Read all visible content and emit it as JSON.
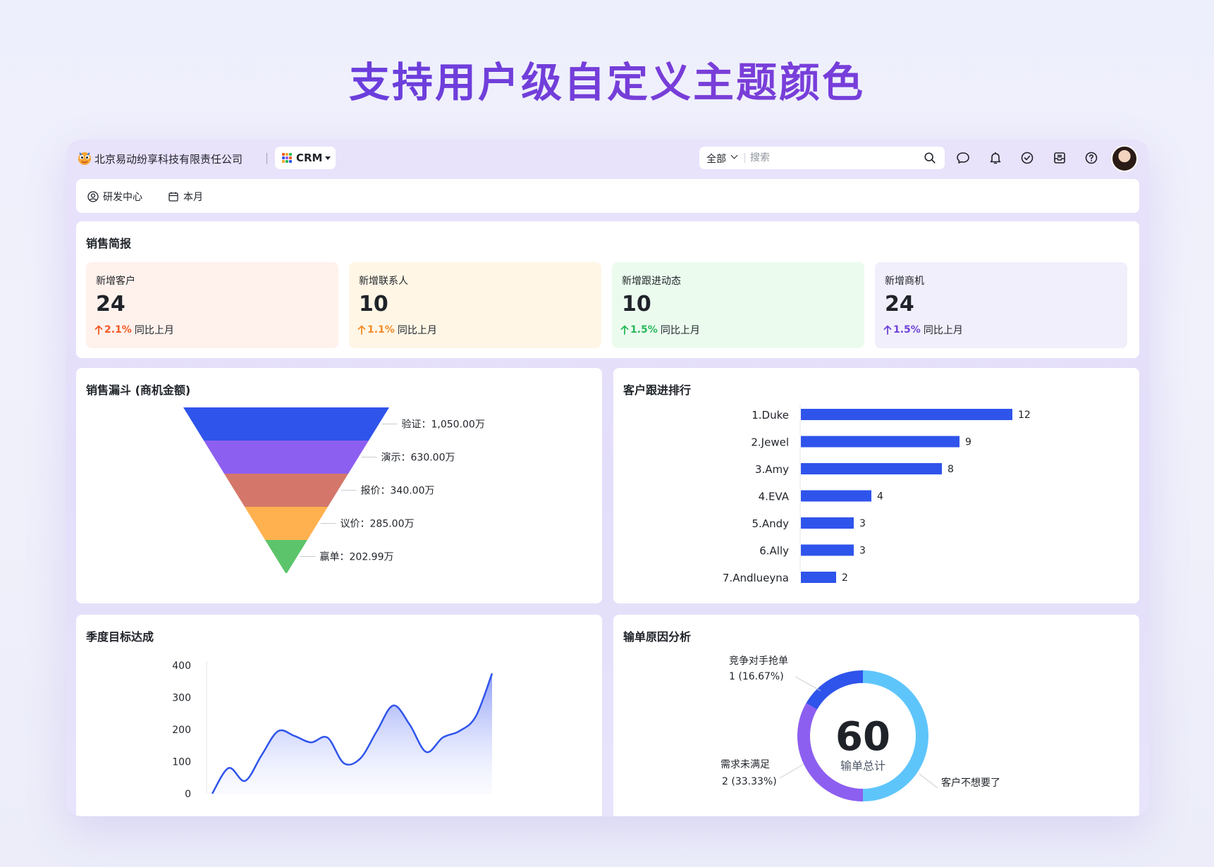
{
  "hero": {
    "title": "支持用户级自定义主题颜色"
  },
  "topbar": {
    "company": "北京易动纷享科技有限责任公司",
    "app_name": "CRM",
    "search_scope": "全部",
    "search_placeholder": "搜索"
  },
  "filters": {
    "department": "研发中心",
    "period": "本月"
  },
  "sales_brief": {
    "title": "销售简报",
    "stats": [
      {
        "label": "新增客户",
        "value": "24",
        "change": "2.1%",
        "compare": "同比上月",
        "color": "#f15a24",
        "bg": "#fff1ec"
      },
      {
        "label": "新增联系人",
        "value": "10",
        "change": "1.1%",
        "compare": "同比上月",
        "color": "#f28c28",
        "bg": "#fff6e6"
      },
      {
        "label": "新增跟进动态",
        "value": "10",
        "change": "1.5%",
        "compare": "同比上月",
        "color": "#2ab85a",
        "bg": "#ebfcef"
      },
      {
        "label": "新增商机",
        "value": "24",
        "change": "1.5%",
        "compare": "同比上月",
        "color": "#6e44d8",
        "bg": "#f1effb"
      }
    ]
  },
  "funnel": {
    "title": "销售漏斗 (商机金额)",
    "chart_data": {
      "type": "funnel",
      "stages": [
        {
          "name": "验证",
          "value": 1050.0,
          "label": "验证：1,050.00万",
          "color": "#2f54eb"
        },
        {
          "name": "演示",
          "value": 630.0,
          "label": "演示：630.00万",
          "color": "#8d5ff0"
        },
        {
          "name": "报价",
          "value": 340.0,
          "label": "报价：340.00万",
          "color": "#d4776a"
        },
        {
          "name": "议价",
          "value": 285.0,
          "label": "议价：285.00万",
          "color": "#ffb14f"
        },
        {
          "name": "赢单",
          "value": 202.99,
          "label": "赢单：202.99万",
          "color": "#5cc46a"
        }
      ]
    }
  },
  "ranking": {
    "title": "客户跟进排行",
    "chart_data": {
      "type": "bar",
      "orientation": "horizontal",
      "categories": [
        "1.Duke",
        "2.Jewel",
        "3.Amy",
        "4.EVA",
        "5.Andy",
        "6.Ally",
        "7.Andlueyna"
      ],
      "values": [
        12,
        9,
        8,
        4,
        3,
        3,
        2
      ],
      "color": "#2f54eb"
    }
  },
  "quarterly": {
    "title": "季度目标达成",
    "chart_data": {
      "type": "area",
      "ylim": [
        0,
        400
      ],
      "yticks": [
        "0",
        "100",
        "200",
        "300",
        "400"
      ],
      "values": [
        0,
        80,
        40,
        120,
        195,
        180,
        160,
        175,
        95,
        110,
        195,
        275,
        215,
        130,
        175,
        195,
        240,
        375
      ],
      "color": "#2f54eb"
    }
  },
  "loss": {
    "title": "输单原因分析",
    "total": "60",
    "total_label": "输单总计",
    "chart_data": {
      "type": "pie",
      "slices": [
        {
          "name": "竞争对手抢单",
          "count": 1,
          "pct": "16.67%",
          "label": "1 (16.67%)",
          "color": "#2f54eb"
        },
        {
          "name": "需求未满足",
          "count": 2,
          "pct": "33.33%",
          "label": "2 (33.33%)",
          "color": "#8d5ff0"
        },
        {
          "name": "客户不想要了",
          "count": 3,
          "pct": "50%",
          "color": "#5ec5fb"
        }
      ]
    }
  }
}
